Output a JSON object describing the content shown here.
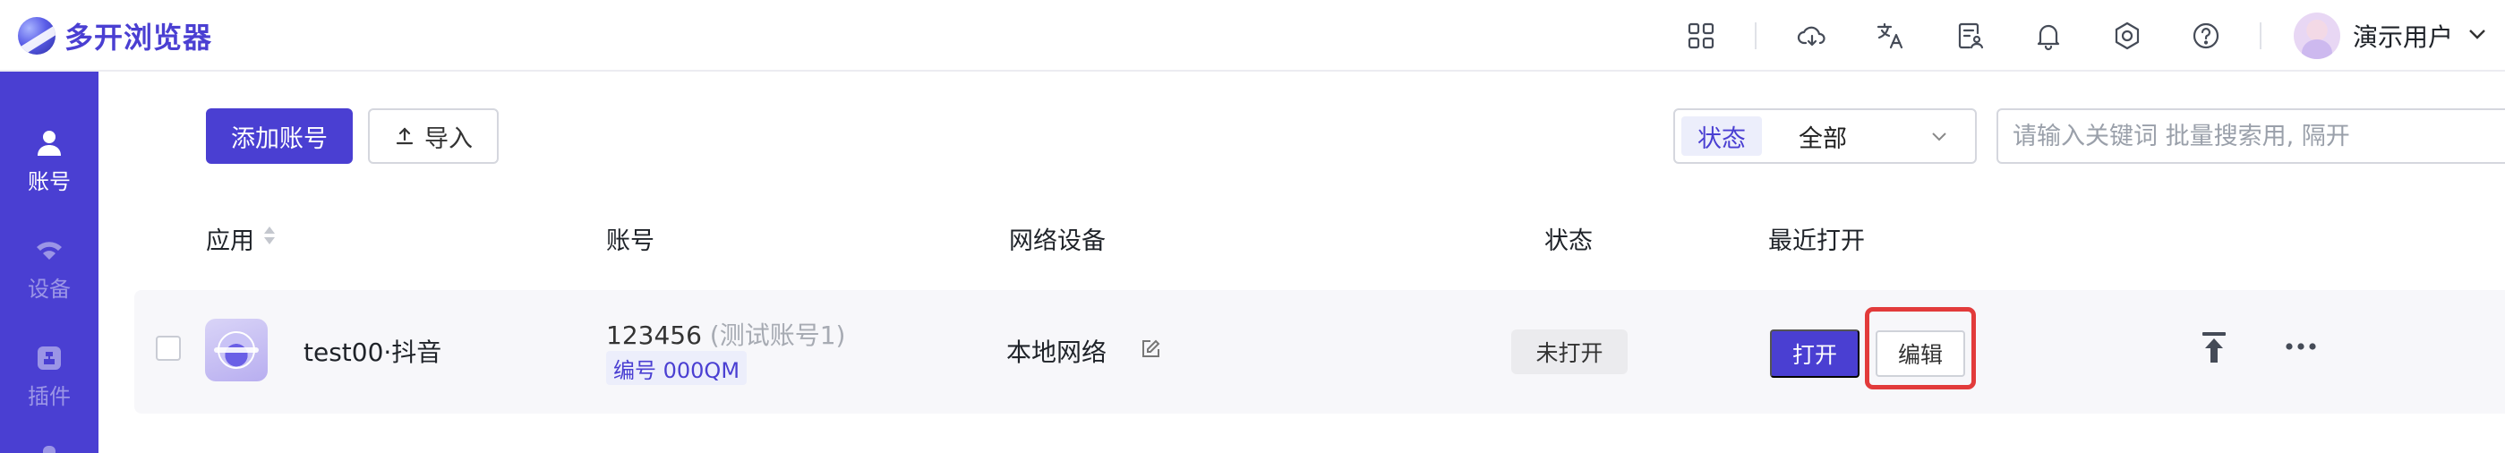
{
  "app": {
    "name": "多开浏览器"
  },
  "header": {
    "icons": [
      "apps-grid-icon",
      "cloud-sync-icon",
      "translate-icon",
      "contacts-doc-icon",
      "bell-icon",
      "settings-icon",
      "help-icon"
    ],
    "user_name": "演示用户"
  },
  "sidebar": {
    "items": [
      {
        "label": "账号",
        "icon": "user-icon",
        "active": true
      },
      {
        "label": "设备",
        "icon": "wifi-icon",
        "active": false
      },
      {
        "label": "插件",
        "icon": "plugin-icon",
        "active": false
      }
    ]
  },
  "toolbar": {
    "add_label": "添加账号",
    "import_label": "导入"
  },
  "filter": {
    "status_label": "状态",
    "status_value": "全部",
    "search_placeholder": "请输入关键词 批量搜索用, 隔开"
  },
  "table": {
    "columns": {
      "app": "应用",
      "account": "账号",
      "network": "网络设备",
      "status": "状态",
      "last_open": "最近打开"
    },
    "rows": [
      {
        "app_name": "test00·抖音",
        "account_id": "123456",
        "account_note": "(测试账号1)",
        "serial": "编号 000QM",
        "network": "本地网络",
        "status": "未打开",
        "open_label": "打开",
        "edit_label": "编辑"
      }
    ]
  },
  "colors": {
    "brand": "#4a3fd2",
    "highlight": "#e23b3b"
  }
}
